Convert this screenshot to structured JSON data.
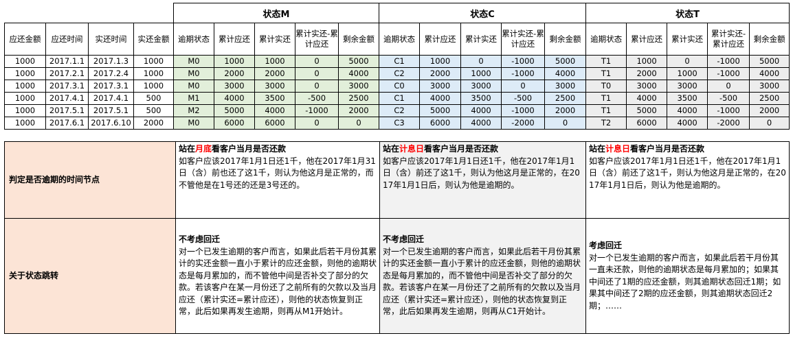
{
  "top": {
    "groups": [
      "状态M",
      "状态C",
      "状态T"
    ],
    "base_headers": [
      "应还金额",
      "应还时间",
      "实还时间",
      "实还金额"
    ],
    "status_headers": [
      "逾期状态",
      "累计应还",
      "累计实还",
      "累计实还-累计应还",
      "剩余金额"
    ],
    "rows": [
      [
        "1000",
        "2017.1.1",
        "2017.1.3",
        "1000",
        "M0",
        "1000",
        "1000",
        "0",
        "5000",
        "C1",
        "1000",
        "0",
        "-1000",
        "5000",
        "T1",
        "1000",
        "0",
        "-1000",
        "5000"
      ],
      [
        "1000",
        "2017.2.1",
        "2017.2.4",
        "1000",
        "M0",
        "2000",
        "2000",
        "0",
        "4000",
        "C2",
        "2000",
        "1000",
        "-1000",
        "4000",
        "T1",
        "2000",
        "1000",
        "-1000",
        "4000"
      ],
      [
        "1000",
        "2017.3.1",
        "2017.3.1",
        "1000",
        "M0",
        "3000",
        "3000",
        "0",
        "3000",
        "C0",
        "3000",
        "3000",
        "0",
        "3000",
        "T0",
        "3000",
        "3000",
        "0",
        "3000"
      ],
      [
        "1000",
        "2017.4.1",
        "2017.4.1",
        "500",
        "M1",
        "4000",
        "3500",
        "-500",
        "2500",
        "C1",
        "4000",
        "3500",
        "-500",
        "2500",
        "T1",
        "4000",
        "3500",
        "-500",
        "2500"
      ],
      [
        "1000",
        "2017.5.1",
        "2017.5.1",
        "500",
        "M2",
        "5000",
        "4000",
        "-1000",
        "2000",
        "C2",
        "5000",
        "4000",
        "-1000",
        "2000",
        "T1",
        "5000",
        "4000",
        "-1000",
        "2000"
      ],
      [
        "1000",
        "2017.6.1",
        "2017.6.10",
        "2000",
        "M0",
        "6000",
        "6000",
        "0",
        "0",
        "C3",
        "6000",
        "4000",
        "-2000",
        "0",
        "T2",
        "6000",
        "4000",
        "-2000",
        "0"
      ]
    ]
  },
  "bottom": {
    "row1": {
      "label": "判定是否逾期的时间节点",
      "m": {
        "heading_pre": "站在",
        "heading_red": "月底",
        "heading_post": "看客户当月是否还款",
        "body": "如客户应该2017年1月1日还1千，他在2017年1月31日（含）前也还了这1千，则认为他这月是正常的，而不管他是在1号还的还是3号还的。"
      },
      "c": {
        "heading_pre": "站在",
        "heading_red": "计息日",
        "heading_post": "看客户当月是否还款",
        "body": "如客户应该2017年1月1日还1千，他在2017年1月1日（含）前还了这1千，则认为他这月是正常的，在2017年1月1日后，则认为他是逾期的。"
      },
      "t": {
        "heading_pre": "站在",
        "heading_red": "计息日",
        "heading_post": "看客户当月是否还款",
        "body": "如客户应该2017年1月1日还1千，他在2017年1月1日（含）前还了这1千，则认为他这月是正常的，在2017年1月1日后，则认为他是逾期的。"
      }
    },
    "row2": {
      "label": "关于状态跳转",
      "m": {
        "heading": "不考虑回迁",
        "body": "对一个已发生逾期的客户而言，如果此后若干月份其累计的实还金额一直小于累计的应还金额，则他的逾期状态是每月累加的，而不管他中间是否补交了部分的欠款。若该客户在某一月份还了之前所有的欠款以及当月应还（累计实还=累计应还），则他的状态恢复到正常，此后如果再发生逾期，则再从M1开始计。"
      },
      "c": {
        "heading": "不考虑回迁",
        "body": "对一个已发生逾期的客户而言，如果此后若干月份其累计的实还金额一直小于累计的应还金额，则他的逾期状态是每月累加的，而不管他中间是否补交了部分的欠款。若该客户在某一月份还了之前所有的欠款以及当月应还（累计实还=累计应还），则他的状态恢复到正常，此后如果再发生逾期，则再从C1开始计。"
      },
      "t": {
        "heading": "考虑回迁",
        "body": "对一个已发生逾期的客户而言，如果此后若干月份其一直未还款，则他的逾期状态是每月累加的；如果其中间还了1期的应还金额，则其逾期状态回迁1期；如果其中间还了2期的应还金额，则其逾期状态回迁2期；……"
      }
    }
  },
  "colors": {
    "m_fill": "#e2efda",
    "c_fill": "#ddebf7",
    "t_fill": "#ededed",
    "label_fill": "#fce4d6",
    "highlight": "#ff0000"
  }
}
